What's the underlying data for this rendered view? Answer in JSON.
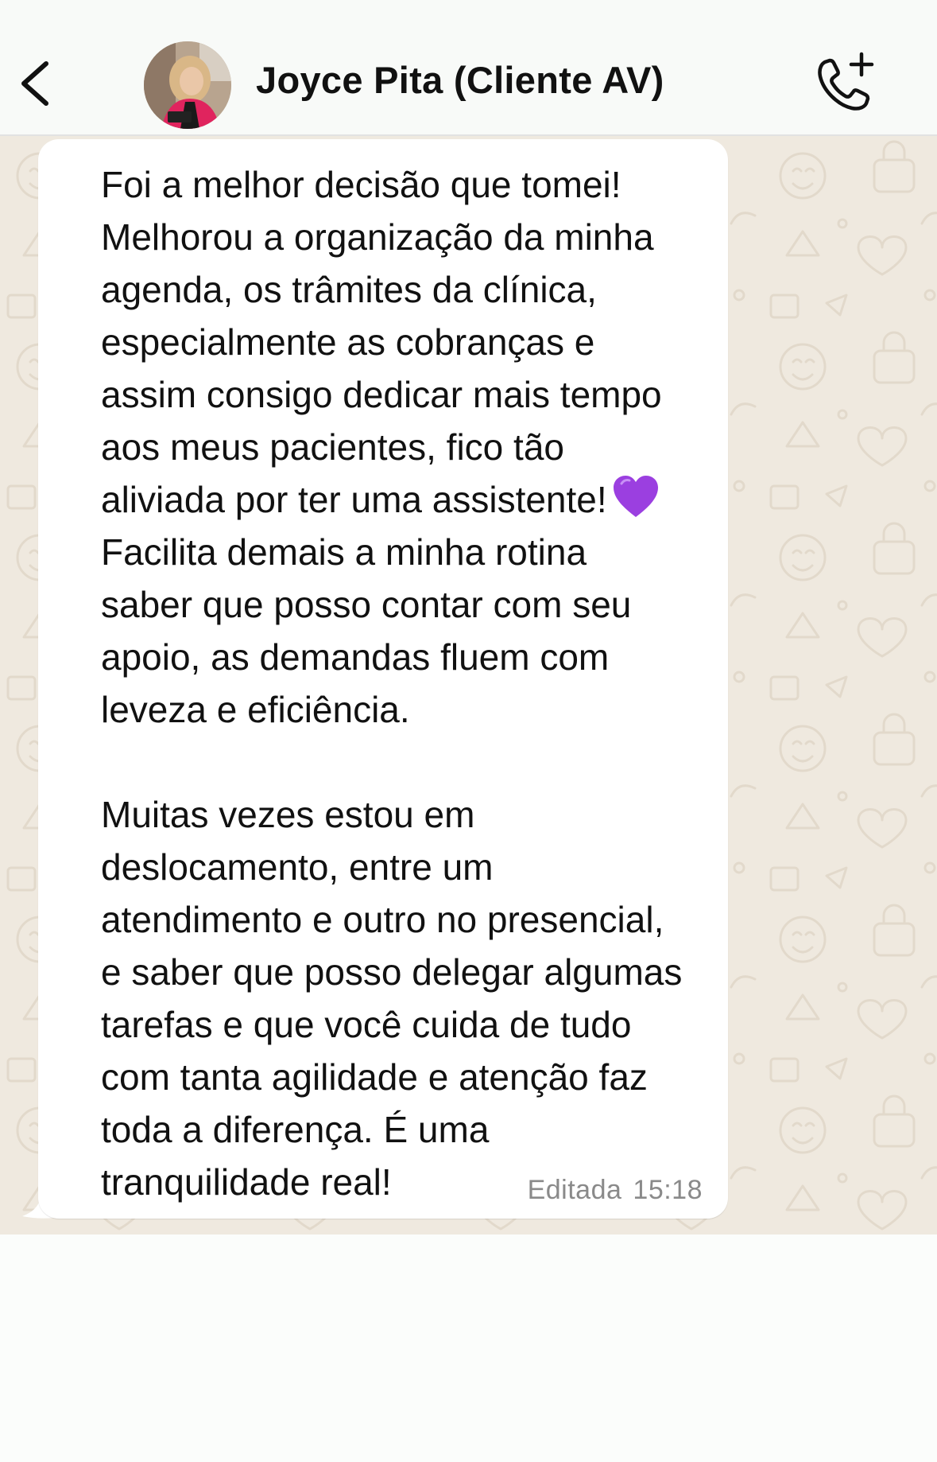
{
  "header": {
    "back_icon": "chevron-left-icon",
    "contact_name": "Joyce Pita (Cliente AV)",
    "call_icon": "phone-add-icon",
    "accent_color": "#111111"
  },
  "chat": {
    "wallpaper_color": "#efe9df",
    "bubble_color": "#ffffff",
    "message": {
      "text_part1": "Foi a melhor decisão que tomei!\nMelhorou a organização da minha\nagenda, os trâmites da clínica,\nespecialmente as cobranças e\nassim consigo dedicar mais tempo\naos meus pacientes, fico tão\naliviada por ter uma assistente!",
      "emoji": "purple-heart-icon",
      "text_part2": "\nFacilita demais a minha rotina\nsaber que posso contar com seu\napoio, as demandas fluem com\nleveza e eficiência.\n\nMuitas vezes estou em\ndeslocamento, entre um\natendimento e outro no presencial,\ne saber que posso delegar algumas\ntarefas e que você cuida de tudo\ncom tanta agilidade e atenção faz\ntoda a diferença. É uma\ntranquilidade real!",
      "edited_label": "Editada",
      "time": "15:18",
      "emoji_color": "#9b3fe0"
    }
  }
}
